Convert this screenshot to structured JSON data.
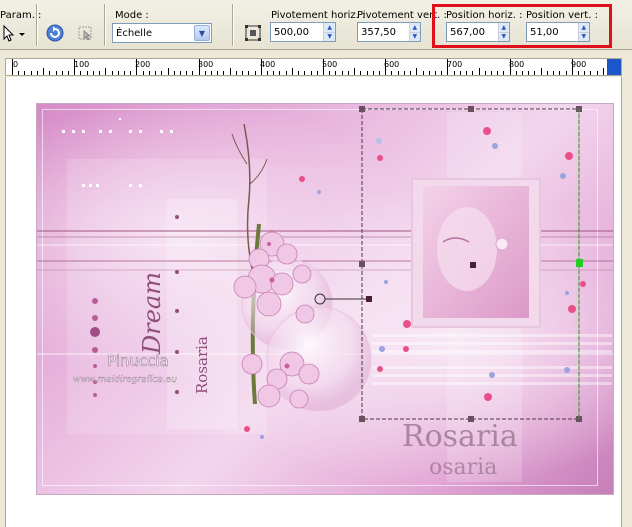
{
  "toolbar": {
    "param_label": "Param. :",
    "mode_label": "Mode :",
    "mode_value": "Échelle",
    "pivot_h_label": "Pivotement horiz. :",
    "pivot_h_value": "500,00",
    "pivot_v_label": "Pivotement vert. :",
    "pivot_v_value": "357,50",
    "pos_h_label": "Position horiz. :",
    "pos_h_value": "567,00",
    "pos_v_label": "Position vert. :",
    "pos_v_value": "51,00"
  },
  "ruler": {
    "ticks": [
      "0",
      "100",
      "200",
      "300",
      "400",
      "500",
      "600",
      "700",
      "800",
      "900"
    ]
  },
  "image_text": {
    "watermark_name": "Pinuccia",
    "watermark_url": "www.maidiregrafica.eu",
    "dream": "Dream",
    "rosaria_small": "Rosaria",
    "rosaria_big": "Rosaria",
    "rosaria_signature": "osaria"
  },
  "colors": {
    "highlight": "#e0101a",
    "accent_pink": "#d68cc7",
    "selection_handle": "#6b5060",
    "pivot_handle": "#22cc22"
  }
}
